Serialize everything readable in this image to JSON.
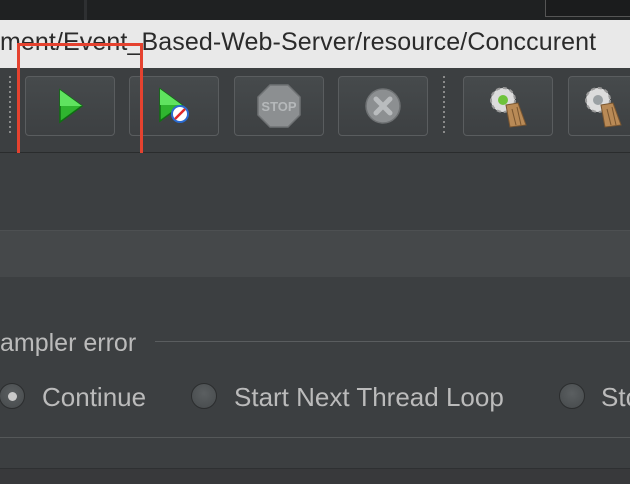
{
  "window": {
    "path_title": "ment/Event_Based-Web-Server/resource/Conccurent"
  },
  "toolbar": {
    "buttons": [
      {
        "name": "start",
        "icon": "green-play-icon"
      },
      {
        "name": "start-no-pauses",
        "icon": "green-play-with-clock-icon"
      },
      {
        "name": "stop",
        "icon": "stop-sign-icon"
      },
      {
        "name": "shutdown",
        "icon": "gray-x-circle-icon"
      },
      {
        "name": "clear",
        "icon": "gear-broom-icon"
      },
      {
        "name": "clear-all",
        "icon": "gear-broom-icon"
      }
    ],
    "highlight_color": "#e5422f"
  },
  "sampler_error": {
    "label": "ampler error",
    "options": [
      {
        "label": "Continue",
        "selected": true
      },
      {
        "label": "Start Next Thread Loop",
        "selected": false
      },
      {
        "label": "Sto",
        "selected": false
      }
    ]
  },
  "colors": {
    "background": "#3c3f41",
    "titlebar": "#e9e9e9",
    "text": "#bbbbbb"
  }
}
